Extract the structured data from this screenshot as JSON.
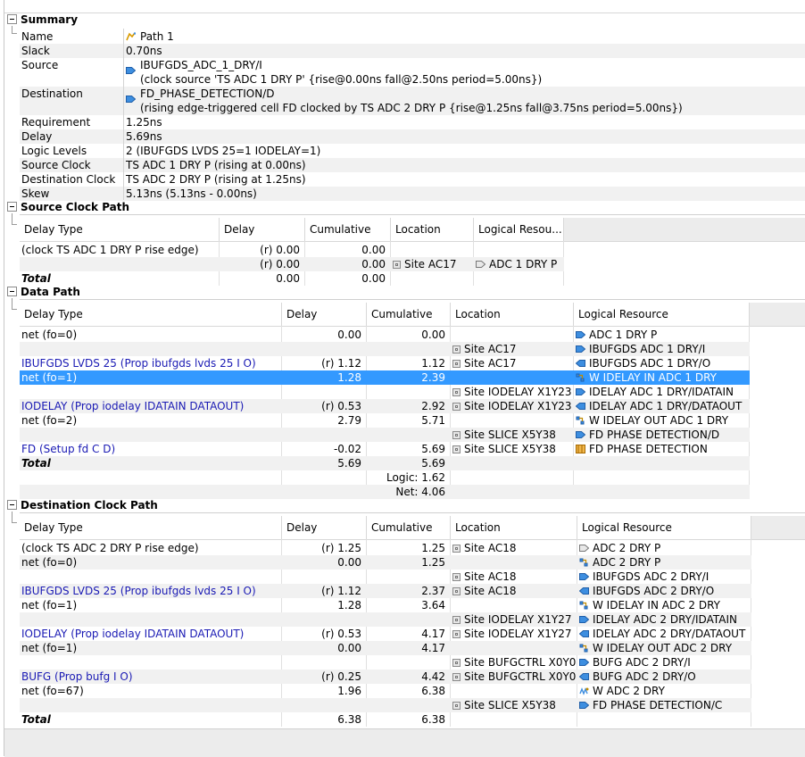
{
  "summary": {
    "title": "Summary",
    "rows": [
      {
        "key": "Name",
        "value": "Path 1",
        "icon": "path-icon"
      },
      {
        "key": "Slack",
        "value": "0.70ns"
      },
      {
        "key": "Source",
        "value": "IBUFGDS_ADC_1_DRY/I",
        "value2": "(clock source 'TS  ADC  1  DRY  P' {rise@0.00ns fall@2.50ns period=5.00ns})",
        "icon": "input-port-icon"
      },
      {
        "key": "Destination",
        "value": "FD_PHASE_DETECTION/D",
        "value2": "(rising edge-triggered cell FD clocked by TS  ADC  2  DRY  P {rise@1.25ns fall@3.75ns period=5.00ns})",
        "icon": "input-port-icon"
      },
      {
        "key": "Requirement",
        "value": "1.25ns"
      },
      {
        "key": "Delay",
        "value": "5.69ns"
      },
      {
        "key": "Logic Levels",
        "value": "2  (IBUFGDS  LVDS  25=1 IODELAY=1)"
      },
      {
        "key": "Source Clock",
        "value": "TS  ADC  1  DRY  P (rising at 0.00ns)"
      },
      {
        "key": "Destination Clock",
        "value": "TS  ADC  2  DRY  P (rising at 1.25ns)"
      },
      {
        "key": "Skew",
        "value": "5.13ns (5.13ns - 0.00ns)"
      }
    ]
  },
  "source_clock_path": {
    "title": "Source Clock Path",
    "headers": [
      "Delay Type",
      "Delay",
      "Cumulative",
      "Location",
      "Logical Resou..."
    ],
    "rows": [
      {
        "type": "(clock TS  ADC  1  DRY  P rise edge)",
        "delay": "(r) 0.00",
        "cum": "0.00",
        "loc": "",
        "res": ""
      },
      {
        "type": "",
        "delay": "(r) 0.00",
        "cum": "0.00",
        "loc": "Site AC17",
        "res": "ADC  1  DRY  P"
      },
      {
        "type": "Total",
        "delay": "0.00",
        "cum": "0.00",
        "loc": "",
        "res": ""
      }
    ]
  },
  "data_path": {
    "title": "Data Path",
    "headers": [
      "Delay Type",
      "Delay",
      "Cumulative",
      "Location",
      "Logical Resource"
    ],
    "rows": [
      {
        "type": "net (fo=0)",
        "delay": "0.00",
        "cum": "0.00",
        "loc": "",
        "res": "ADC  1  DRY  P"
      },
      {
        "type": "",
        "delay": "",
        "cum": "",
        "loc": "Site AC17",
        "res": "IBUFGDS  ADC  1  DRY/I"
      },
      {
        "type": "IBUFGDS  LVDS  25 (Prop  ibufgds  lvds  25  I  O)",
        "delay": "(r) 1.12",
        "cum": "1.12",
        "loc": "Site AC17",
        "res": "IBUFGDS  ADC  1  DRY/O"
      },
      {
        "type": "net (fo=1)",
        "delay": "1.28",
        "cum": "2.39",
        "loc": "",
        "res": "W  IDELAY  IN  ADC  1  DRY"
      },
      {
        "type": "",
        "delay": "",
        "cum": "",
        "loc": "Site IODELAY  X1Y23",
        "res": "IDELAY  ADC  1  DRY/IDATAIN"
      },
      {
        "type": "IODELAY (Prop  iodelay  IDATAIN  DATAOUT)",
        "delay": "(r) 0.53",
        "cum": "2.92",
        "loc": "Site IODELAY  X1Y23",
        "res": "IDELAY  ADC  1  DRY/DATAOUT"
      },
      {
        "type": "net (fo=2)",
        "delay": "2.79",
        "cum": "5.71",
        "loc": "",
        "res": "W  IDELAY  OUT  ADC  1  DRY"
      },
      {
        "type": "",
        "delay": "",
        "cum": "",
        "loc": "Site SLICE  X5Y38",
        "res": "FD  PHASE  DETECTION/D"
      },
      {
        "type": "FD (Setup  fd  C  D)",
        "delay": "-0.02",
        "cum": "5.69",
        "loc": "Site SLICE  X5Y38",
        "res": "FD  PHASE  DETECTION"
      },
      {
        "type": "Total",
        "delay": "5.69",
        "cum": "5.69",
        "loc": "",
        "res": ""
      },
      {
        "type": "",
        "delay": "",
        "cum": "Logic: 1.62",
        "loc": "",
        "res": ""
      },
      {
        "type": "",
        "delay": "",
        "cum": "Net: 4.06",
        "loc": "",
        "res": ""
      }
    ]
  },
  "dest_clock_path": {
    "title": "Destination Clock Path",
    "headers": [
      "Delay Type",
      "Delay",
      "Cumulative",
      "Location",
      "Logical Resource"
    ],
    "rows": [
      {
        "type": "(clock TS  ADC  2  DRY  P rise edge)",
        "delay": "(r) 1.25",
        "cum": "1.25",
        "loc": "Site AC18",
        "res": "ADC  2  DRY  P"
      },
      {
        "type": "net (fo=0)",
        "delay": "0.00",
        "cum": "1.25",
        "loc": "",
        "res": "ADC  2  DRY  P"
      },
      {
        "type": "",
        "delay": "",
        "cum": "",
        "loc": "Site AC18",
        "res": "IBUFGDS  ADC  2  DRY/I"
      },
      {
        "type": "IBUFGDS  LVDS  25 (Prop  ibufgds  lvds  25  I  O)",
        "delay": "(r) 1.12",
        "cum": "2.37",
        "loc": "Site AC18",
        "res": "IBUFGDS  ADC  2  DRY/O"
      },
      {
        "type": "net (fo=1)",
        "delay": "1.28",
        "cum": "3.64",
        "loc": "",
        "res": "W  IDELAY  IN  ADC  2  DRY"
      },
      {
        "type": "",
        "delay": "",
        "cum": "",
        "loc": "Site IODELAY  X1Y27",
        "res": "IDELAY  ADC  2  DRY/IDATAIN"
      },
      {
        "type": "IODELAY (Prop  iodelay  IDATAIN  DATAOUT)",
        "delay": "(r) 0.53",
        "cum": "4.17",
        "loc": "Site IODELAY  X1Y27",
        "res": "IDELAY  ADC  2  DRY/DATAOUT"
      },
      {
        "type": "net (fo=1)",
        "delay": "0.00",
        "cum": "4.17",
        "loc": "",
        "res": "W  IDELAY  OUT  ADC  2  DRY"
      },
      {
        "type": "",
        "delay": "",
        "cum": "",
        "loc": "Site BUFGCTRL  X0Y0",
        "res": "BUFG  ADC  2  DRY/I"
      },
      {
        "type": "BUFG (Prop  bufg  I  O)",
        "delay": "(r) 0.25",
        "cum": "4.42",
        "loc": "Site BUFGCTRL  X0Y0",
        "res": "BUFG  ADC  2  DRY/O"
      },
      {
        "type": "net (fo=67)",
        "delay": "1.96",
        "cum": "6.38",
        "loc": "",
        "res": "W  ADC  2  DRY"
      },
      {
        "type": "",
        "delay": "",
        "cum": "",
        "loc": "Site SLICE  X5Y38",
        "res": "FD  PHASE  DETECTION/C"
      },
      {
        "type": "Total",
        "delay": "6.38",
        "cum": "6.38",
        "loc": "",
        "res": ""
      }
    ]
  },
  "colors": {
    "selection": "#3399ff",
    "link": "#1a1ab4",
    "alt_row": "#f1f1f1",
    "header_fill": "#ececec"
  }
}
